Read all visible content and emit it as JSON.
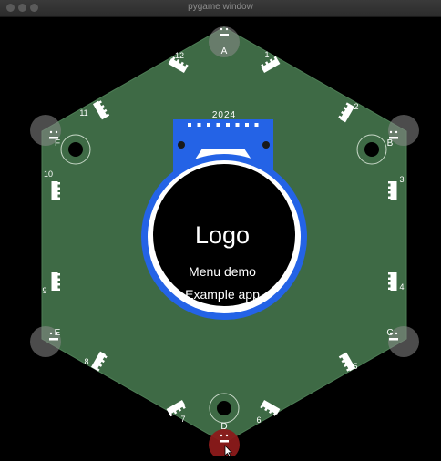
{
  "window": {
    "title": "pygame window",
    "buttons": [
      "close",
      "minimize",
      "zoom"
    ]
  },
  "colors": {
    "board": "#3e6a45",
    "board_edge": "#4d7d55",
    "accent_blue": "#2463e6",
    "display_bg": "#000000",
    "touch_pad": "#8a8a8a",
    "active_pad": "#8b1a1a",
    "text": "#ffffff"
  },
  "board": {
    "year": "2024",
    "logo": "Logo",
    "menu_items": [
      "Menu demo",
      "Example app"
    ],
    "leds": [
      {
        "number": "1"
      },
      {
        "number": "2"
      },
      {
        "number": "3"
      },
      {
        "number": "4"
      },
      {
        "number": "5"
      },
      {
        "number": "6"
      },
      {
        "number": "7"
      },
      {
        "number": "8"
      },
      {
        "number": "9"
      },
      {
        "number": "10"
      },
      {
        "number": "11"
      },
      {
        "number": "12"
      }
    ],
    "petals": [
      {
        "letter": "A",
        "active": false
      },
      {
        "letter": "B",
        "active": false
      },
      {
        "letter": "C",
        "active": false
      },
      {
        "letter": "D",
        "active": true
      },
      {
        "letter": "E",
        "active": false
      },
      {
        "letter": "F",
        "active": false
      }
    ]
  }
}
